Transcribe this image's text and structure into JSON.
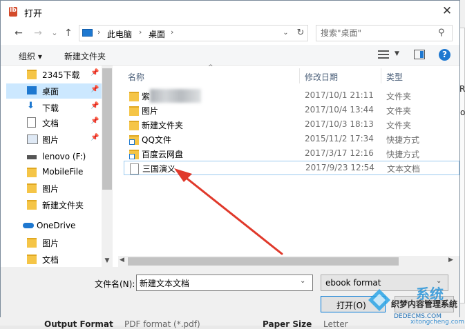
{
  "dialog": {
    "title": "打开",
    "close_glyph": "✕"
  },
  "nav": {
    "back_glyph": "←",
    "forward_glyph": "→",
    "recent_glyph": "⌄",
    "up_glyph": "↑",
    "breadcrumb": [
      "此电脑",
      "桌面"
    ],
    "search_placeholder": "搜索\"桌面\""
  },
  "toolbar": {
    "organize": "组织 ▾",
    "new_folder": "新建文件夹"
  },
  "sidebar": {
    "items": [
      {
        "label": "2345下载",
        "icon": "folder-icon",
        "pinned": true
      },
      {
        "label": "桌面",
        "icon": "desktop-icon",
        "pinned": true,
        "selected": true
      },
      {
        "label": "下载",
        "icon": "download-icon",
        "pinned": true
      },
      {
        "label": "文档",
        "icon": "document-icon",
        "pinned": true
      },
      {
        "label": "图片",
        "icon": "picture-icon",
        "pinned": true
      },
      {
        "label": "lenovo (F:)",
        "icon": "drive-icon"
      },
      {
        "label": "MobileFile",
        "icon": "folder-icon"
      },
      {
        "label": "图片",
        "icon": "folder-icon"
      },
      {
        "label": "新建文件夹",
        "icon": "folder-icon"
      },
      {
        "label": "OneDrive",
        "icon": "onedrive-icon"
      },
      {
        "label": "图片",
        "icon": "folder-icon"
      },
      {
        "label": "文档",
        "icon": "folder-icon"
      }
    ]
  },
  "filelist": {
    "columns": {
      "name": "名称",
      "date": "修改日期",
      "type": "类型"
    },
    "rows": [
      {
        "name": "紫",
        "date": "2017/10/1 21:11",
        "type": "文件夹",
        "icon": "folder-icon",
        "blurred": true
      },
      {
        "name": "图片",
        "date": "2017/10/4 13:44",
        "type": "文件夹",
        "icon": "folder-icon"
      },
      {
        "name": "新建文件夹",
        "date": "2017/10/3 18:13",
        "type": "文件夹",
        "icon": "folder-icon"
      },
      {
        "name": "QQ文件",
        "date": "2015/11/2 17:34",
        "type": "快捷方式",
        "icon": "shortcut-icon"
      },
      {
        "name": "百度云网盘",
        "date": "2017/3/17 12:16",
        "type": "快捷方式",
        "icon": "shortcut-icon"
      },
      {
        "name": "三国演义",
        "date": "2017/9/23 12:54",
        "type": "文本文档",
        "icon": "text-document-icon",
        "selected": true
      }
    ]
  },
  "bottom": {
    "filename_label": "文件名(N):",
    "filename_value": "新建文本文档",
    "filetype": "ebook format",
    "open": "打开(O)"
  },
  "background_app": {
    "output_format": "Output Format",
    "output_value": "PDF format (*.pdf)",
    "paper_size": "Paper Size",
    "paper_value": "Letter",
    "edge_text_1": "Re",
    "edge_text_2": "o"
  },
  "watermark": {
    "line1": "织梦内容管理系统",
    "line2": "DEDECMS.COM",
    "big": "系统",
    "site": "xitongcheng.com"
  },
  "colors": {
    "accent": "#1e78d0",
    "arrow": "#e0392b",
    "selection": "#cce8ff"
  }
}
